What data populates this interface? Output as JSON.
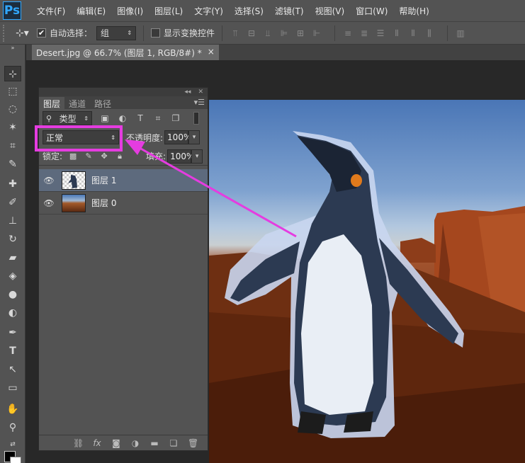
{
  "app": {
    "logo": "Ps",
    "accent": "#31a8ff"
  },
  "menu": [
    "文件(F)",
    "编辑(E)",
    "图像(I)",
    "图层(L)",
    "文字(Y)",
    "选择(S)",
    "滤镜(T)",
    "视图(V)",
    "窗口(W)",
    "帮助(H)"
  ],
  "options_bar": {
    "auto_select_label": "自动选择：",
    "auto_select_checked": true,
    "auto_select_value": "组",
    "show_transform_label": "显示变换控件",
    "show_transform_checked": false
  },
  "document": {
    "tab_title": "Desert.jpg @ 66.7% (图层 1, RGB/8#) *",
    "close_glyph": "×"
  },
  "layers_panel": {
    "tabs": [
      "图层",
      "通道",
      "路径"
    ],
    "filter_kind": "类型",
    "blend_mode": "正常",
    "opacity_label": "不透明度:",
    "opacity_value": "100%",
    "lock_label": "锁定:",
    "fill_label": "填充:",
    "fill_value": "100%",
    "layers": [
      {
        "name": "图层 1",
        "visible": true,
        "selected": true
      },
      {
        "name": "图层 0",
        "visible": true,
        "selected": false
      }
    ]
  },
  "annotation": {
    "highlight_color": "#e53ce0"
  },
  "colors": {
    "foreground": "#000000",
    "background": "#ffffff"
  }
}
